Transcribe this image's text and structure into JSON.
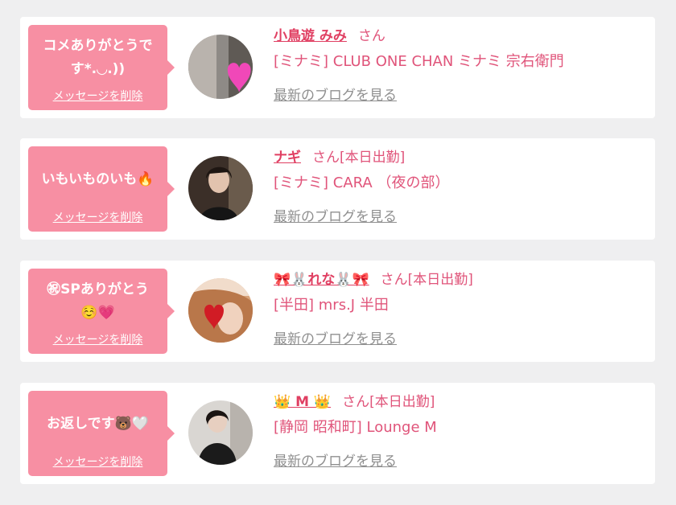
{
  "cards": [
    {
      "message": "コメありがとうで\nす*.◡.))",
      "delete_label": "メッセージを削除",
      "name": "小鳥遊 みみ",
      "suffix": "さん",
      "shop": "[ミナミ] CLUB ONE CHAN ミナミ 宗右衛門",
      "blog_link": "最新のブログを見る"
    },
    {
      "message": "いもいものいも🔥",
      "delete_label": "メッセージを削除",
      "name": "ナギ",
      "suffix": "さん[本日出勤]",
      "shop": "[ミナミ] CARA （夜の部）",
      "blog_link": "最新のブログを見る"
    },
    {
      "message": "㊗SPありがとう\n☺️💗",
      "delete_label": "メッセージを削除",
      "name": "🎀🐰れな🐰🎀",
      "suffix": "さん[本日出勤]",
      "shop": "[半田] mrs.J 半田",
      "blog_link": "最新のブログを見る"
    },
    {
      "message": "お返しです🐻🤍",
      "delete_label": "メッセージを削除",
      "name": "👑 M 👑",
      "suffix": "さん[本日出勤]",
      "shop": "[静岡 昭和町] Lounge M",
      "blog_link": "最新のブログを見る"
    }
  ],
  "colors": {
    "page_bg": "#efeff0",
    "bubble": "#f78fa3",
    "name": "#e03f62",
    "text_pink": "#e0547a",
    "link_gray": "#8f8f8f"
  }
}
